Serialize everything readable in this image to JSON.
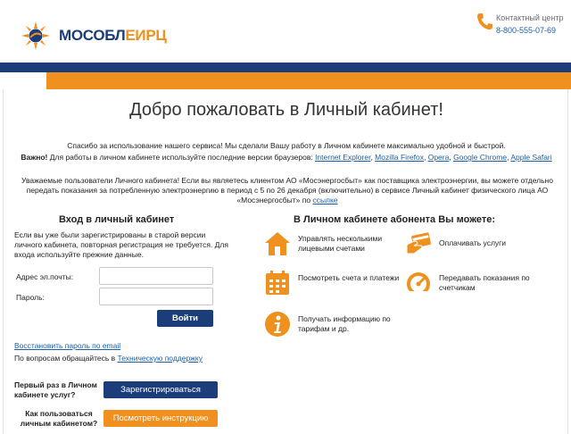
{
  "header": {
    "logo_prefix": "МОСОБЛ",
    "logo_accent": "ЕИРЦ",
    "contact_label": "Контактный центр",
    "contact_phone": "8-800-555-07-69"
  },
  "colors": {
    "brand_blue": "#1b3d7a",
    "brand_orange": "#f0901e",
    "link": "#1b5fa8"
  },
  "main": {
    "title": "Добро пожаловать в Личный кабинет!",
    "thanks": "Спасибо за использование нашего сервиса! Мы сделали Вашу работу в Личном кабинете максимально удобной и быстрой.",
    "browsers_label": "Важно!",
    "browsers_text": " Для работы в личном кабинете используйте последние версии браузеров: ",
    "browsers": [
      "Internet Explorer",
      "Mozilla Firefox",
      "Opera",
      "Google Chrome",
      "Apple Safari"
    ],
    "notice_text": "Уважаемые пользователи Личного кабинета! Если вы являетесь клиентом АО «Мосэнергосбыт» как поставщика электроэнергии, вы можете отдельно передать показания за потребленную электроэнергию в период с 5 по 26 декабря (включительно) в сервисе Личный кабинет физического лица АО «Мосэнергосбыт» по ",
    "notice_link": "ссылке"
  },
  "login": {
    "heading": "Вход в личный кабинет",
    "note": "Если вы уже были зарегистрированы в старой версии личного кабинета, повторная регистрация не требуется. Для входа используйте прежние данные.",
    "email_label": "Адрес эл.почты:",
    "password_label": "Пароль:",
    "email_value": "",
    "password_value": "",
    "login_button": "Войти",
    "restore_link": "Восстановить пароль по email",
    "support_text": "По вопросам обращайтесь в ",
    "support_link": "Техническую поддержку",
    "first_time": "Первый раз в Личном кабинете услуг?",
    "register_button": "Зарегистрироваться",
    "how_to": "Как пользоваться личным кабинетом?",
    "guide_button": "Посмотреть инструкцию"
  },
  "features": {
    "heading": "В Личном кабинете абонента Вы можете:",
    "items": [
      {
        "icon": "house-icon",
        "text": "Управлять несколькими лицевыми счетами"
      },
      {
        "icon": "card-payment-icon",
        "text": "Оплачивать услуги"
      },
      {
        "icon": "calendar-icon",
        "text": "Посмотреть счета и платежи"
      },
      {
        "icon": "gauge-icon",
        "text": "Передавать показания по счетчикам"
      },
      {
        "icon": "info-icon",
        "text": "Получать информацию по тарифам и др."
      }
    ]
  }
}
